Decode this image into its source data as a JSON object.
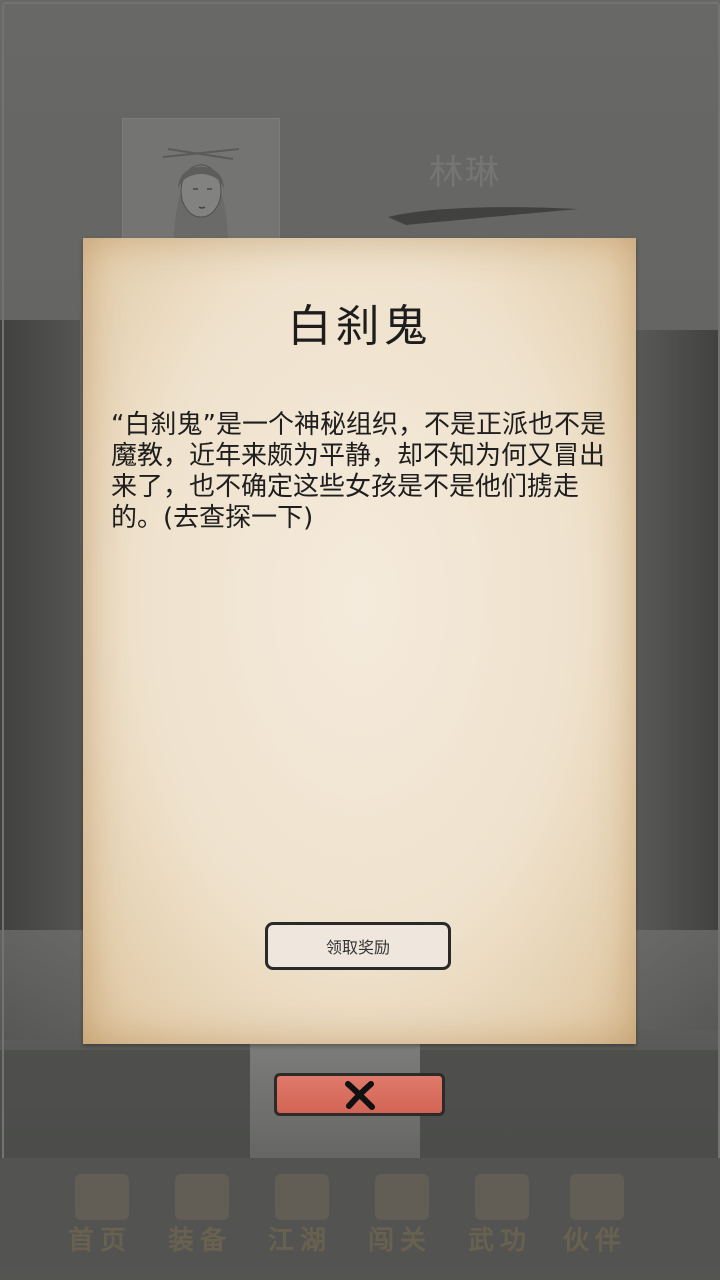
{
  "character": {
    "name": "林琳"
  },
  "dialog": {
    "title": "白刹鬼",
    "body": "“白刹鬼”是一个神秘组织，不是正派也不是魔教，近年来颇为平静，却不知为何又冒出来了，也不确定这些女孩是不是他们掳走的。(去查探一下)",
    "reward_button": "领取奖励",
    "close_icon": "close-x-icon"
  },
  "bottom_nav": {
    "items": [
      {
        "label": "首页",
        "icon": "home-gate-icon"
      },
      {
        "label": "装备",
        "icon": "equipment-pot-icon"
      },
      {
        "label": "江湖",
        "icon": "jianghu-scroll-icon"
      },
      {
        "label": "闯关",
        "icon": "swords-icon"
      },
      {
        "label": "武功",
        "icon": "martial-book-icon"
      },
      {
        "label": "伙伴",
        "icon": "companions-icon"
      }
    ]
  },
  "colors": {
    "close_button": "#d96a5b",
    "paper": "#efe2cd",
    "nav_label": "#7b7056"
  }
}
